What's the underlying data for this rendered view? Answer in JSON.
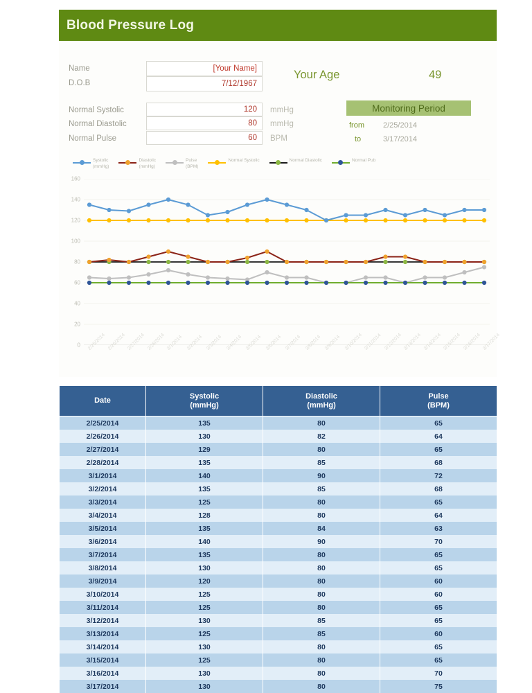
{
  "document": {
    "title": "Blood Pressure Log"
  },
  "identity": {
    "name_label": "Name",
    "name_value": "[Your Name]",
    "dob_label": "D.O.B",
    "dob_value": "7/12/1967",
    "age_label": "Your Age",
    "age_value": "49"
  },
  "normals": {
    "systolic_label": "Normal Systolic",
    "systolic_value": "120",
    "systolic_unit": "mmHg",
    "diastolic_label": "Normal Diastolic",
    "diastolic_value": "80",
    "diastolic_unit": "mmHg",
    "pulse_label": "Normal Pulse",
    "pulse_value": "60",
    "pulse_unit": "BPM"
  },
  "monitoring_period": {
    "title": "Monitoring Period",
    "from_label": "from",
    "from_value": "2/25/2014",
    "to_label": "to",
    "to_value": "3/17/2014"
  },
  "colors": {
    "header_green": "#5f8a13",
    "accent_green": "#7a962f",
    "mon_box_green": "#a6c173",
    "table_header_blue": "#356092",
    "row_odd": "#b9d4ea",
    "row_even": "#e2eef8",
    "value_red": "#c0392b",
    "systolic": "#5b9bd5",
    "diastolic": "#8b2317",
    "diastolic_marker": "#f0a22e",
    "pulse": "#bfbfbf",
    "normal_systolic": "#ffc000",
    "normal_diastolic": "#1a1a1a",
    "normal_diastolic_marker": "#8cb843",
    "normal_pulse": "#70ad2f",
    "normal_pulse_marker": "#2f5597"
  },
  "table": {
    "columns": [
      {
        "main": "Date",
        "sub": ""
      },
      {
        "main": "Systolic",
        "sub": "(mmHg)"
      },
      {
        "main": "Diastolic",
        "sub": "(mmHg)"
      },
      {
        "main": "Pulse",
        "sub": "(BPM)"
      }
    ],
    "rows": [
      [
        "2/25/2014",
        "135",
        "80",
        "65"
      ],
      [
        "2/26/2014",
        "130",
        "82",
        "64"
      ],
      [
        "2/27/2014",
        "129",
        "80",
        "65"
      ],
      [
        "2/28/2014",
        "135",
        "85",
        "68"
      ],
      [
        "3/1/2014",
        "140",
        "90",
        "72"
      ],
      [
        "3/2/2014",
        "135",
        "85",
        "68"
      ],
      [
        "3/3/2014",
        "125",
        "80",
        "65"
      ],
      [
        "3/4/2014",
        "128",
        "80",
        "64"
      ],
      [
        "3/5/2014",
        "135",
        "84",
        "63"
      ],
      [
        "3/6/2014",
        "140",
        "90",
        "70"
      ],
      [
        "3/7/2014",
        "135",
        "80",
        "65"
      ],
      [
        "3/8/2014",
        "130",
        "80",
        "65"
      ],
      [
        "3/9/2014",
        "120",
        "80",
        "60"
      ],
      [
        "3/10/2014",
        "125",
        "80",
        "60"
      ],
      [
        "3/11/2014",
        "125",
        "80",
        "65"
      ],
      [
        "3/12/2014",
        "130",
        "85",
        "65"
      ],
      [
        "3/13/2014",
        "125",
        "85",
        "60"
      ],
      [
        "3/14/2014",
        "130",
        "80",
        "65"
      ],
      [
        "3/15/2014",
        "125",
        "80",
        "65"
      ],
      [
        "3/16/2014",
        "130",
        "80",
        "70"
      ],
      [
        "3/17/2014",
        "130",
        "80",
        "75"
      ]
    ]
  },
  "chart_data": {
    "type": "line",
    "title": "",
    "xlabel": "",
    "ylabel": "",
    "ylim": [
      0,
      160
    ],
    "yticks": [
      0,
      20,
      40,
      60,
      80,
      100,
      120,
      140,
      160
    ],
    "grid": true,
    "legend_position": "top",
    "categories": [
      "2/25/2014",
      "2/26/2014",
      "2/27/2014",
      "2/28/2014",
      "3/1/2014",
      "3/2/2014",
      "3/3/2014",
      "3/4/2014",
      "3/5/2014",
      "3/6/2014",
      "3/7/2014",
      "3/8/2014",
      "3/9/2014",
      "3/10/2014",
      "3/11/2014",
      "3/12/2014",
      "3/13/2014",
      "3/14/2014",
      "3/15/2014",
      "3/16/2014",
      "3/17/2014"
    ],
    "series": [
      {
        "name": "Systolic",
        "unit": "(mmHg)",
        "color": "#5b9bd5",
        "marker_color": "#5b9bd5",
        "values": [
          135,
          130,
          129,
          135,
          140,
          135,
          125,
          128,
          135,
          140,
          135,
          130,
          120,
          125,
          125,
          130,
          125,
          130,
          125,
          130,
          130
        ]
      },
      {
        "name": "Diastolic",
        "unit": "(mmHg)",
        "color": "#8b2317",
        "marker_color": "#f0a22e",
        "values": [
          80,
          82,
          80,
          85,
          90,
          85,
          80,
          80,
          84,
          90,
          80,
          80,
          80,
          80,
          80,
          85,
          85,
          80,
          80,
          80,
          80
        ]
      },
      {
        "name": "Pulse",
        "unit": "(BPM)",
        "color": "#bfbfbf",
        "marker_color": "#bfbfbf",
        "values": [
          65,
          64,
          65,
          68,
          72,
          68,
          65,
          64,
          63,
          70,
          65,
          65,
          60,
          60,
          65,
          65,
          60,
          65,
          65,
          70,
          75
        ]
      },
      {
        "name": "Normal Systolic",
        "unit": "",
        "color": "#ffc000",
        "marker_color": "#ffc000",
        "values": [
          120,
          120,
          120,
          120,
          120,
          120,
          120,
          120,
          120,
          120,
          120,
          120,
          120,
          120,
          120,
          120,
          120,
          120,
          120,
          120,
          120
        ]
      },
      {
        "name": "Normal Diastolic",
        "unit": "",
        "color": "#1a1a1a",
        "marker_color": "#8cb843",
        "values": [
          80,
          80,
          80,
          80,
          80,
          80,
          80,
          80,
          80,
          80,
          80,
          80,
          80,
          80,
          80,
          80,
          80,
          80,
          80,
          80,
          80
        ]
      },
      {
        "name": "Normal Pub",
        "unit": "",
        "color": "#70ad2f",
        "marker_color": "#2f5597",
        "values": [
          60,
          60,
          60,
          60,
          60,
          60,
          60,
          60,
          60,
          60,
          60,
          60,
          60,
          60,
          60,
          60,
          60,
          60,
          60,
          60,
          60
        ]
      }
    ]
  }
}
